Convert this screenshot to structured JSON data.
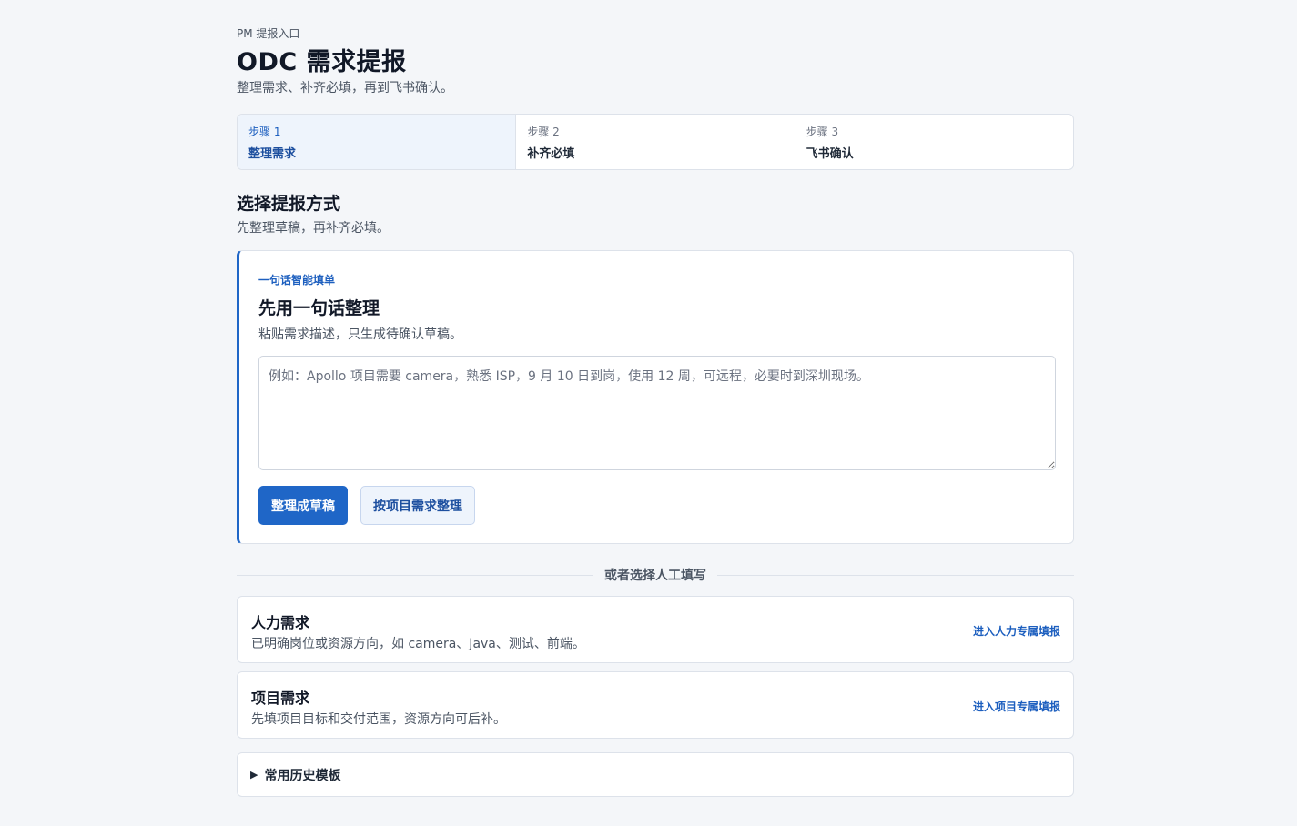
{
  "header": {
    "eyebrow": "PM 提报入口",
    "title": "ODC 需求提报",
    "subtitle": "整理需求、补齐必填，再到飞书确认。"
  },
  "steps": [
    {
      "number": "步骤 1",
      "label": "整理需求",
      "active": true
    },
    {
      "number": "步骤 2",
      "label": "补齐必填",
      "active": false
    },
    {
      "number": "步骤 3",
      "label": "飞书确认",
      "active": false
    }
  ],
  "section": {
    "title": "选择提报方式",
    "desc": "先整理草稿，再补齐必填。"
  },
  "smart_fill": {
    "tag": "一句话智能填单",
    "title": "先用一句话整理",
    "desc": "粘贴需求描述，只生成待确认草稿。",
    "input_value": "",
    "input_placeholder": "例如：Apollo 项目需要 camera，熟悉 ISP，9 月 10 日到岗，使用 12 周，可远程，必要时到深圳现场。",
    "primary_button": "整理成草稿",
    "secondary_button": "按项目需求整理"
  },
  "divider_text": "或者选择人工填写",
  "options": [
    {
      "title": "人力需求",
      "desc": "已明确岗位或资源方向，如 camera、Java、测试、前端。",
      "link": "进入人力专属填报"
    },
    {
      "title": "项目需求",
      "desc": "先填项目目标和交付范围，资源方向可后补。",
      "link": "进入项目专属填报"
    }
  ],
  "history": {
    "icon": "triangle-right-icon",
    "label": "常用历史模板"
  },
  "colors": {
    "accent": "#1f66c7",
    "background": "#f4f6f9",
    "active_step_bg": "#eef4fc"
  }
}
